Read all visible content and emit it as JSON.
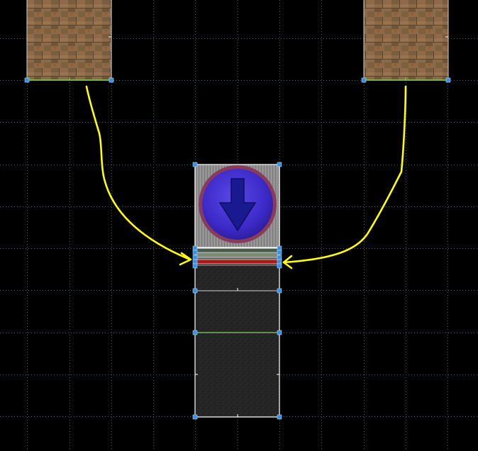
{
  "viewport": {
    "background": "#000000",
    "grid_color": "#3f5a6e",
    "grid_style": "dotted",
    "grid_spacing_units": 16
  },
  "colors": {
    "selection_outline": "#ffffff",
    "vertex_handle": "#3a8fe0",
    "linedef_highlight": "#7fd65a",
    "annotation_arrow": "#ffff00",
    "strip_red": "#b01818",
    "arrow_emblem_blue": "#3a28c8",
    "arrow_emblem_ring": "#8a3a5a"
  },
  "textures": [
    {
      "name": "wood-panel",
      "count": 2
    },
    {
      "name": "blue-down-arrow-emblem",
      "count": 1
    },
    {
      "name": "red-strip",
      "count": 1
    },
    {
      "name": "dark-speckled-floor",
      "count": 2
    }
  ],
  "annotations": [
    {
      "type": "arrow",
      "from": "left-wood-sector",
      "to": "step-strip",
      "color": "yellow"
    },
    {
      "type": "arrow",
      "from": "right-wood-sector",
      "to": "step-strip",
      "color": "yellow"
    }
  ]
}
